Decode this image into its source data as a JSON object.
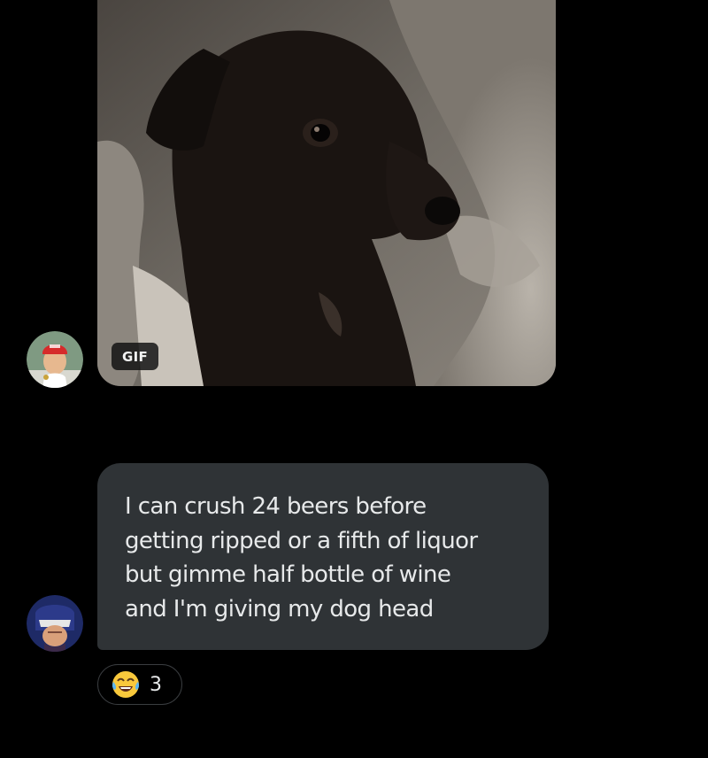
{
  "messages": [
    {
      "type": "gif",
      "badge": "GIF",
      "media_description_icon": "dog-gif-thumbnail"
    },
    {
      "type": "text",
      "text": "I can crush 24 beers before\ngetting ripped or a fifth of liquor\nbut gimme half bottle of wine\nand I'm giving my dog head",
      "reactions": [
        {
          "emoji_icon": "face-with-tears-of-joy-icon",
          "count": "3"
        }
      ]
    }
  ],
  "avatars": [
    {
      "icon": "user-avatar-red-cap"
    },
    {
      "icon": "user-avatar-masked-hero"
    }
  ],
  "theme": {
    "background": "#000000",
    "bubble": "#2f3336",
    "text": "#e7e9ea",
    "pill_border": "#3a3d40"
  }
}
